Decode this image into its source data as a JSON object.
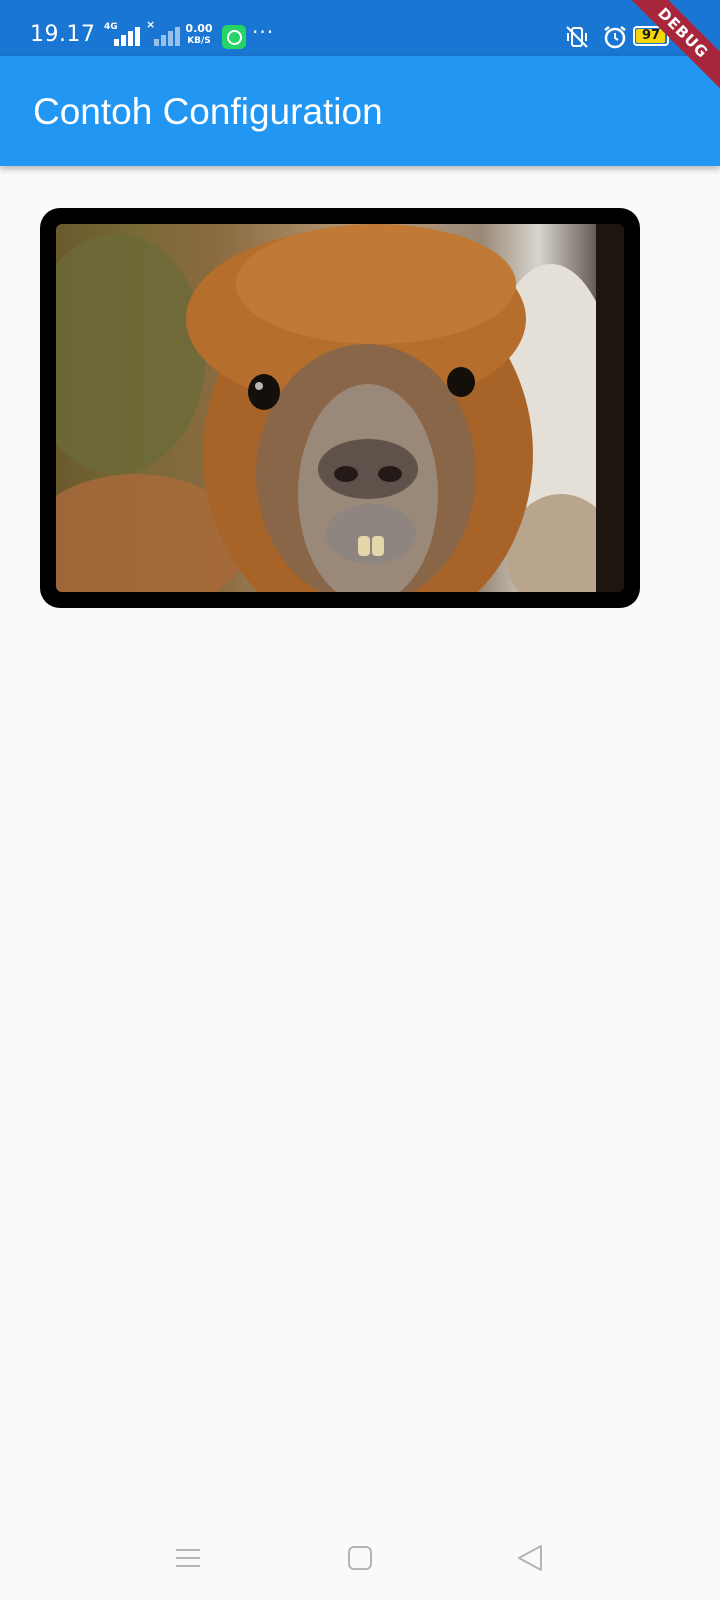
{
  "status_bar": {
    "time": "19.17",
    "network_type": "4G",
    "net_speed_value": "0.00",
    "net_speed_unit": "KB/S",
    "more_indicator": "···",
    "battery_percent": "97",
    "battery_level": 0.97,
    "colors": {
      "background": "#1976d2",
      "battery_fill": "#f5d60a"
    }
  },
  "debug_banner": {
    "label": "DEBUG",
    "color": "#a8263b"
  },
  "app_bar": {
    "title": "Contoh Configuration",
    "color": "#2196f3"
  },
  "content": {
    "image": {
      "subject": "alpaca-photo",
      "frame_color": "#000000"
    }
  },
  "nav_bar": {
    "icons": [
      "menu-icon",
      "home-icon",
      "back-icon"
    ]
  }
}
